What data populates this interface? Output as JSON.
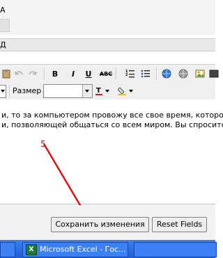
{
  "top": {
    "label": "А"
  },
  "section": {
    "label": "Д"
  },
  "toolbar": {
    "size_label": "Размер",
    "bold": "B",
    "italic": "I",
    "underline": "U",
    "strike": "ABC"
  },
  "editor": {
    "line1": "и, то за компьютером провожу все свое время, которо",
    "line2": "и, позволяющей общаться со всем миром. Вы спросите"
  },
  "annotation": {
    "number": "5",
    "color": "#e01010"
  },
  "buttons": {
    "save": "Сохранить изменения",
    "reset": "Reset Fields"
  },
  "taskbar": {
    "excel": "Microsoft Excel - Гос..."
  }
}
